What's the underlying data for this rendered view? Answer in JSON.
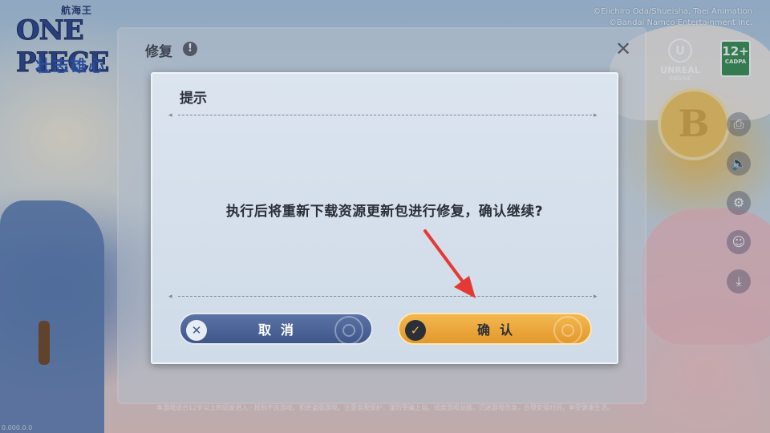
{
  "game": {
    "logo_small": "航海王",
    "logo_big": "ONE PIECE",
    "logo_sub": "壮志雄心",
    "copyright_lines": [
      "©Eiichiro Oda/Shueisha, Toei Animation",
      "©Bandai Namco Entertainment Inc."
    ],
    "engine_label": "UNREAL",
    "engine_sub": "ENGINE",
    "age_rating": "12+",
    "age_rating_sub": "CADPA",
    "emblem_letter": "B",
    "footer_notice": "本游戏适合12岁以上的玩家进入 · 抵制不良游戏，拒绝盗版游戏。注意自我保护，谨防受骗上当。适度游戏益脑，沉迷游戏伤身。合理安排时间，享受健康生活。",
    "version_text": "0.000.0.0"
  },
  "side_icons": [
    {
      "name": "printer-icon",
      "glyph": "⎙"
    },
    {
      "name": "speaker-icon",
      "glyph": "🔈"
    },
    {
      "name": "settings-gear-icon",
      "glyph": "⚙"
    },
    {
      "name": "feedback-icon",
      "glyph": "☺"
    },
    {
      "name": "download-icon",
      "glyph": "⤓"
    }
  ],
  "repair_panel": {
    "title": "修复",
    "info_glyph": "!",
    "close_glyph": "✕"
  },
  "dialog": {
    "title": "提示",
    "message": "执行后将重新下载资源更新包进行修复，确认继续?",
    "cancel_label": "取消",
    "cancel_icon": "✕",
    "confirm_label": "确认",
    "confirm_icon": "✓"
  },
  "colors": {
    "cancel_button": "#4b6298",
    "confirm_button": "#eba93c",
    "annotation_arrow": "#e53935"
  }
}
